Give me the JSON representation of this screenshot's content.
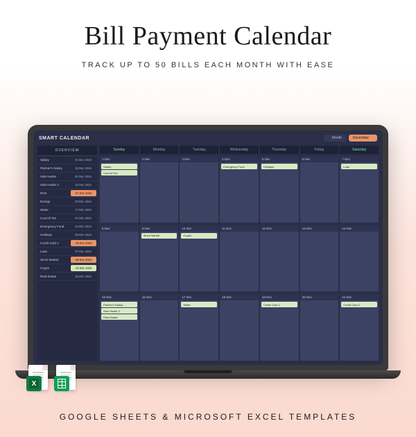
{
  "title": "Bill Payment Calendar",
  "subtitle": "TRACK UP TO 50 BILLS EACH MONTH WITH EASE",
  "footer": "GOOGLE SHEETS & MICROSOFT EXCEL TEMPLATES",
  "app": {
    "name": "SMART CALENDAR",
    "view_label": "Month",
    "month_label": "December"
  },
  "sidebar": {
    "header": "OVERVIEW",
    "rows": [
      {
        "name": "Salary",
        "date": "01 Dec 2024",
        "hl": ""
      },
      {
        "name": "Partner's Salary",
        "date": "15 Dec 2024",
        "hl": ""
      },
      {
        "name": "Side Hustle",
        "date": "02 Dec 2024",
        "hl": ""
      },
      {
        "name": "Side Hustle 2",
        "date": "15 Dec 2024",
        "hl": ""
      },
      {
        "name": "Rent",
        "date": "01 Dec 2024",
        "hl": "hl"
      },
      {
        "name": "Energy",
        "date": "03 Dec 2024",
        "hl": ""
      },
      {
        "name": "Water",
        "date": "17 Dec 2024",
        "hl": ""
      },
      {
        "name": "Council Tax",
        "date": "02 Dec 2024",
        "hl": ""
      },
      {
        "name": "Emergency Fund",
        "date": "04 Dec 2024",
        "hl": ""
      },
      {
        "name": "Holidays",
        "date": "05 Dec 2024",
        "hl": ""
      },
      {
        "name": "Credit Card 1",
        "date": "19 Dec 2024",
        "hl": "hl"
      },
      {
        "name": "Loan",
        "date": "07 Dec 2024",
        "hl": ""
      },
      {
        "name": "Stock Market",
        "date": "09 Dec 2024",
        "hl": "hl"
      },
      {
        "name": "Crypto",
        "date": "10 Dec 2024",
        "hl": "hl2"
      },
      {
        "name": "Real Estate",
        "date": "15 Dec 2024",
        "hl": ""
      }
    ]
  },
  "calendar": {
    "day_headers": [
      "Sunday",
      "Monday",
      "Tuesday",
      "Wednesday",
      "Thursday",
      "Friday",
      "Saturday"
    ],
    "weeks": [
      [
        {
          "label": "1 Dec",
          "items": [
            "Salary",
            "Council Tax"
          ]
        },
        {
          "label": "2 Dec",
          "items": []
        },
        {
          "label": "3 Dec",
          "items": []
        },
        {
          "label": "4 Dec",
          "items": [
            "Emergency Fund"
          ]
        },
        {
          "label": "5 Dec",
          "items": [
            "Holidays"
          ]
        },
        {
          "label": "6 Dec",
          "items": []
        },
        {
          "label": "7 Dec",
          "items": [
            "Loan"
          ]
        }
      ],
      [
        {
          "label": "8 Dec",
          "items": []
        },
        {
          "label": "9 Dec",
          "items": [
            "Stock Market"
          ]
        },
        {
          "label": "10 Dec",
          "items": [
            "Crypto"
          ]
        },
        {
          "label": "11 Dec",
          "items": []
        },
        {
          "label": "12 Dec",
          "items": []
        },
        {
          "label": "13 Dec",
          "items": []
        },
        {
          "label": "14 Dec",
          "items": []
        }
      ],
      [
        {
          "label": "15 Dec",
          "items": [
            "Partner's Salary",
            "Side Hustle 2",
            "Real Estate"
          ]
        },
        {
          "label": "16 Dec",
          "items": []
        },
        {
          "label": "17 Dec",
          "items": [
            "Water"
          ]
        },
        {
          "label": "18 Dec",
          "items": []
        },
        {
          "label": "19 Dec",
          "items": [
            "Credit Card 1"
          ]
        },
        {
          "label": "20 Dec",
          "items": []
        },
        {
          "label": "21 Dec",
          "items": [
            "Credit Card 2"
          ]
        }
      ]
    ]
  },
  "icons": {
    "excel": "Excel",
    "sheets": "Google Sheets"
  }
}
